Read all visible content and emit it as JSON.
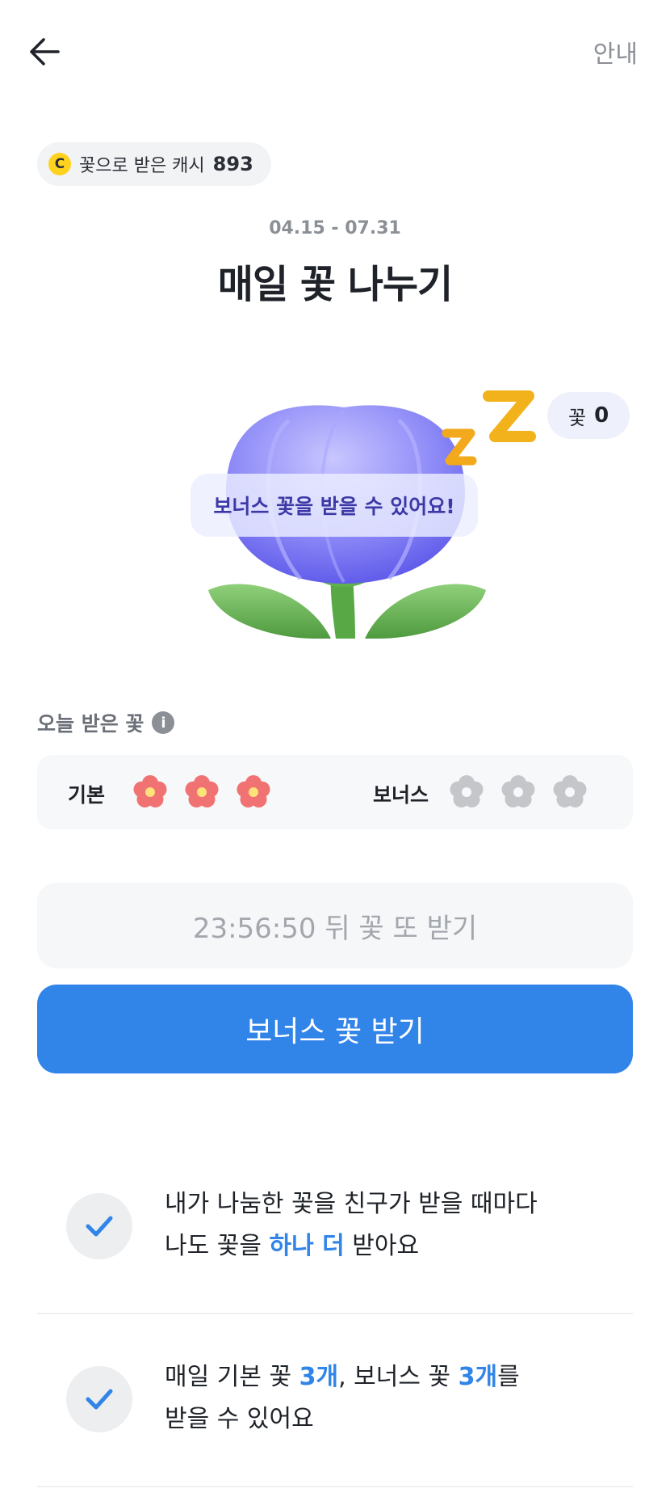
{
  "header": {
    "guide_label": "안내"
  },
  "cash": {
    "coin_symbol": "C",
    "label": "꽃으로 받은 캐시",
    "value": "893"
  },
  "event": {
    "period": "04.15 - 07.31",
    "title": "매일 꽃 나누기"
  },
  "flower_status": {
    "count_label": "꽃",
    "count_value": "0",
    "bonus_message": "보너스 꽃을 받을 수 있어요!"
  },
  "today": {
    "label": "오늘 받은 꽃",
    "info_symbol": "i",
    "basic_label": "기본",
    "bonus_label": "보너스",
    "basic_received": 3,
    "basic_total": 3,
    "bonus_received": 0,
    "bonus_total": 3
  },
  "colors": {
    "accent": "#3184e8",
    "flower_active": "#f07272",
    "flower_inactive": "#c4c6c9",
    "tulip": "#7c7cf7"
  },
  "actions": {
    "timer_text": "23:56:50 뒤 꽃 또 받기",
    "bonus_button": "보너스 꽃 받기"
  },
  "info_rows": [
    {
      "line1": "내가 나눔한 꽃을 친구가 받을 때마다",
      "line2_before": "나도 꽃을 ",
      "line2_highlight": "하나 더",
      "line2_after": " 받아요"
    },
    {
      "line1_a": "매일 기본 꽃 ",
      "line1_h1": "3개",
      "line1_b": ", 보너스 꽃 ",
      "line1_h2": "3개",
      "line1_c": "를",
      "line2": "받을 수 있어요"
    }
  ]
}
